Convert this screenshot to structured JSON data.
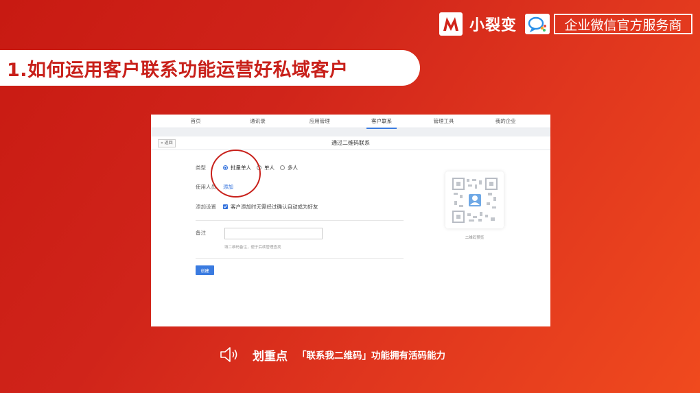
{
  "brand": {
    "logo_icon": "xiaoliebian-logo-icon",
    "name": "小裂变",
    "wecom_icon": "wecom-icon",
    "service_label": "企业微信官方服务商"
  },
  "headline": "1.如何运用客户联系功能运营好私域客户",
  "screenshot": {
    "nav": [
      "首页",
      "通讯录",
      "应用管理",
      "客户联系",
      "管理工具",
      "我的企业"
    ],
    "active_nav": "客户联系",
    "back_label": "« 返回",
    "page_title": "通过二维码联系",
    "type_label": "类型",
    "type_options": [
      "批量单人",
      "单人",
      "多人"
    ],
    "type_selected": "批量单人",
    "user_label": "使用人员",
    "user_add_link": "添加",
    "add_setting_label": "添加设置",
    "add_setting_checkbox": "客户添加时无需经过确认自动成为好友",
    "remark_label": "备注",
    "remark_value": "",
    "remark_hint": "填二维码备注，便于后续管理查找",
    "create_button": "创建",
    "qr_caption": "二维码预览",
    "highlight_color": "#c8201a",
    "accent_color": "#2f6fdc"
  },
  "tip": {
    "icon": "speaker-icon",
    "title": "划重点",
    "text": "「联系我二维码」功能拥有活码能力"
  }
}
